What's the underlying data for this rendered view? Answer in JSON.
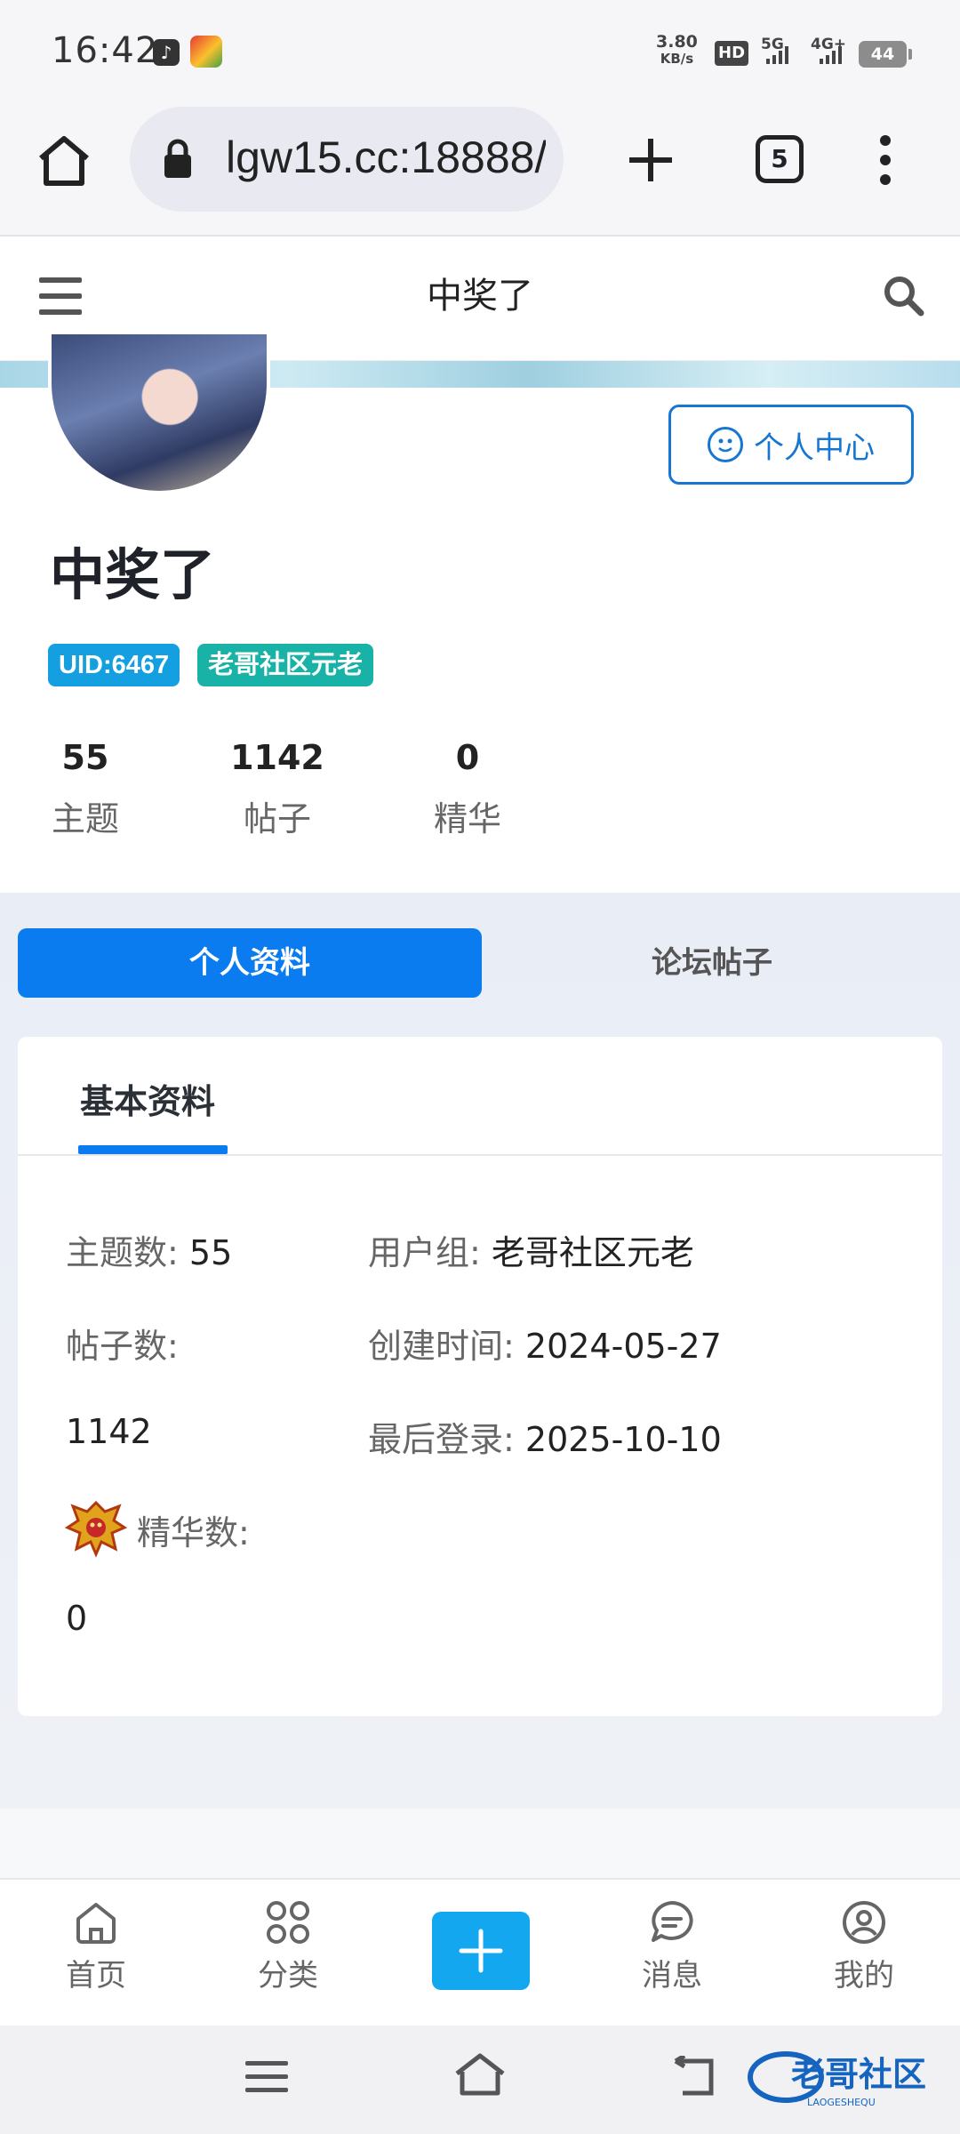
{
  "status_bar": {
    "time": "16:42",
    "net_speed_value": "3.80",
    "net_speed_unit": "KB/s",
    "hd": "HD",
    "sim1": "5G",
    "sim2": "4G+",
    "battery": "44"
  },
  "browser": {
    "url": "lgw15.cc:18888/",
    "tab_count": "5"
  },
  "site_header": {
    "title": "中奖了"
  },
  "profile": {
    "center_button": "个人中心",
    "username": "中奖了",
    "uid_badge": "UID:6467",
    "group_badge": "老哥社区元老",
    "stats": [
      {
        "value": "55",
        "label": "主题"
      },
      {
        "value": "1142",
        "label": "帖子"
      },
      {
        "value": "0",
        "label": "精华"
      }
    ]
  },
  "tabs": {
    "active": "个人资料",
    "inactive": "论坛帖子"
  },
  "card": {
    "tab_label": "基本资料",
    "topics_key": "主题数:",
    "topics_val": "55",
    "posts_key": "帖子数:",
    "posts_val": "1142",
    "digest_key": "精华数:",
    "digest_val": "0",
    "group_key": "用户组:",
    "group_val": "老哥社区元老",
    "created_key": "创建时间:",
    "created_val": "2024-05-27",
    "lastlogin_key": "最后登录:",
    "lastlogin_val": "2025-10-10"
  },
  "bottom_nav": [
    {
      "label": "首页",
      "icon": "home-icon"
    },
    {
      "label": "分类",
      "icon": "grid-icon"
    },
    {
      "label": "",
      "icon": "plus-icon"
    },
    {
      "label": "消息",
      "icon": "message-icon"
    },
    {
      "label": "我的",
      "icon": "user-icon"
    }
  ],
  "watermark": {
    "text": "老哥社区",
    "subtext": "LAOGESHEQU"
  },
  "colors": {
    "accent": "#0a7cf0",
    "uid_badge": "#139fe0",
    "group_badge": "#18b3a6",
    "plus_button": "#13a7f0"
  }
}
